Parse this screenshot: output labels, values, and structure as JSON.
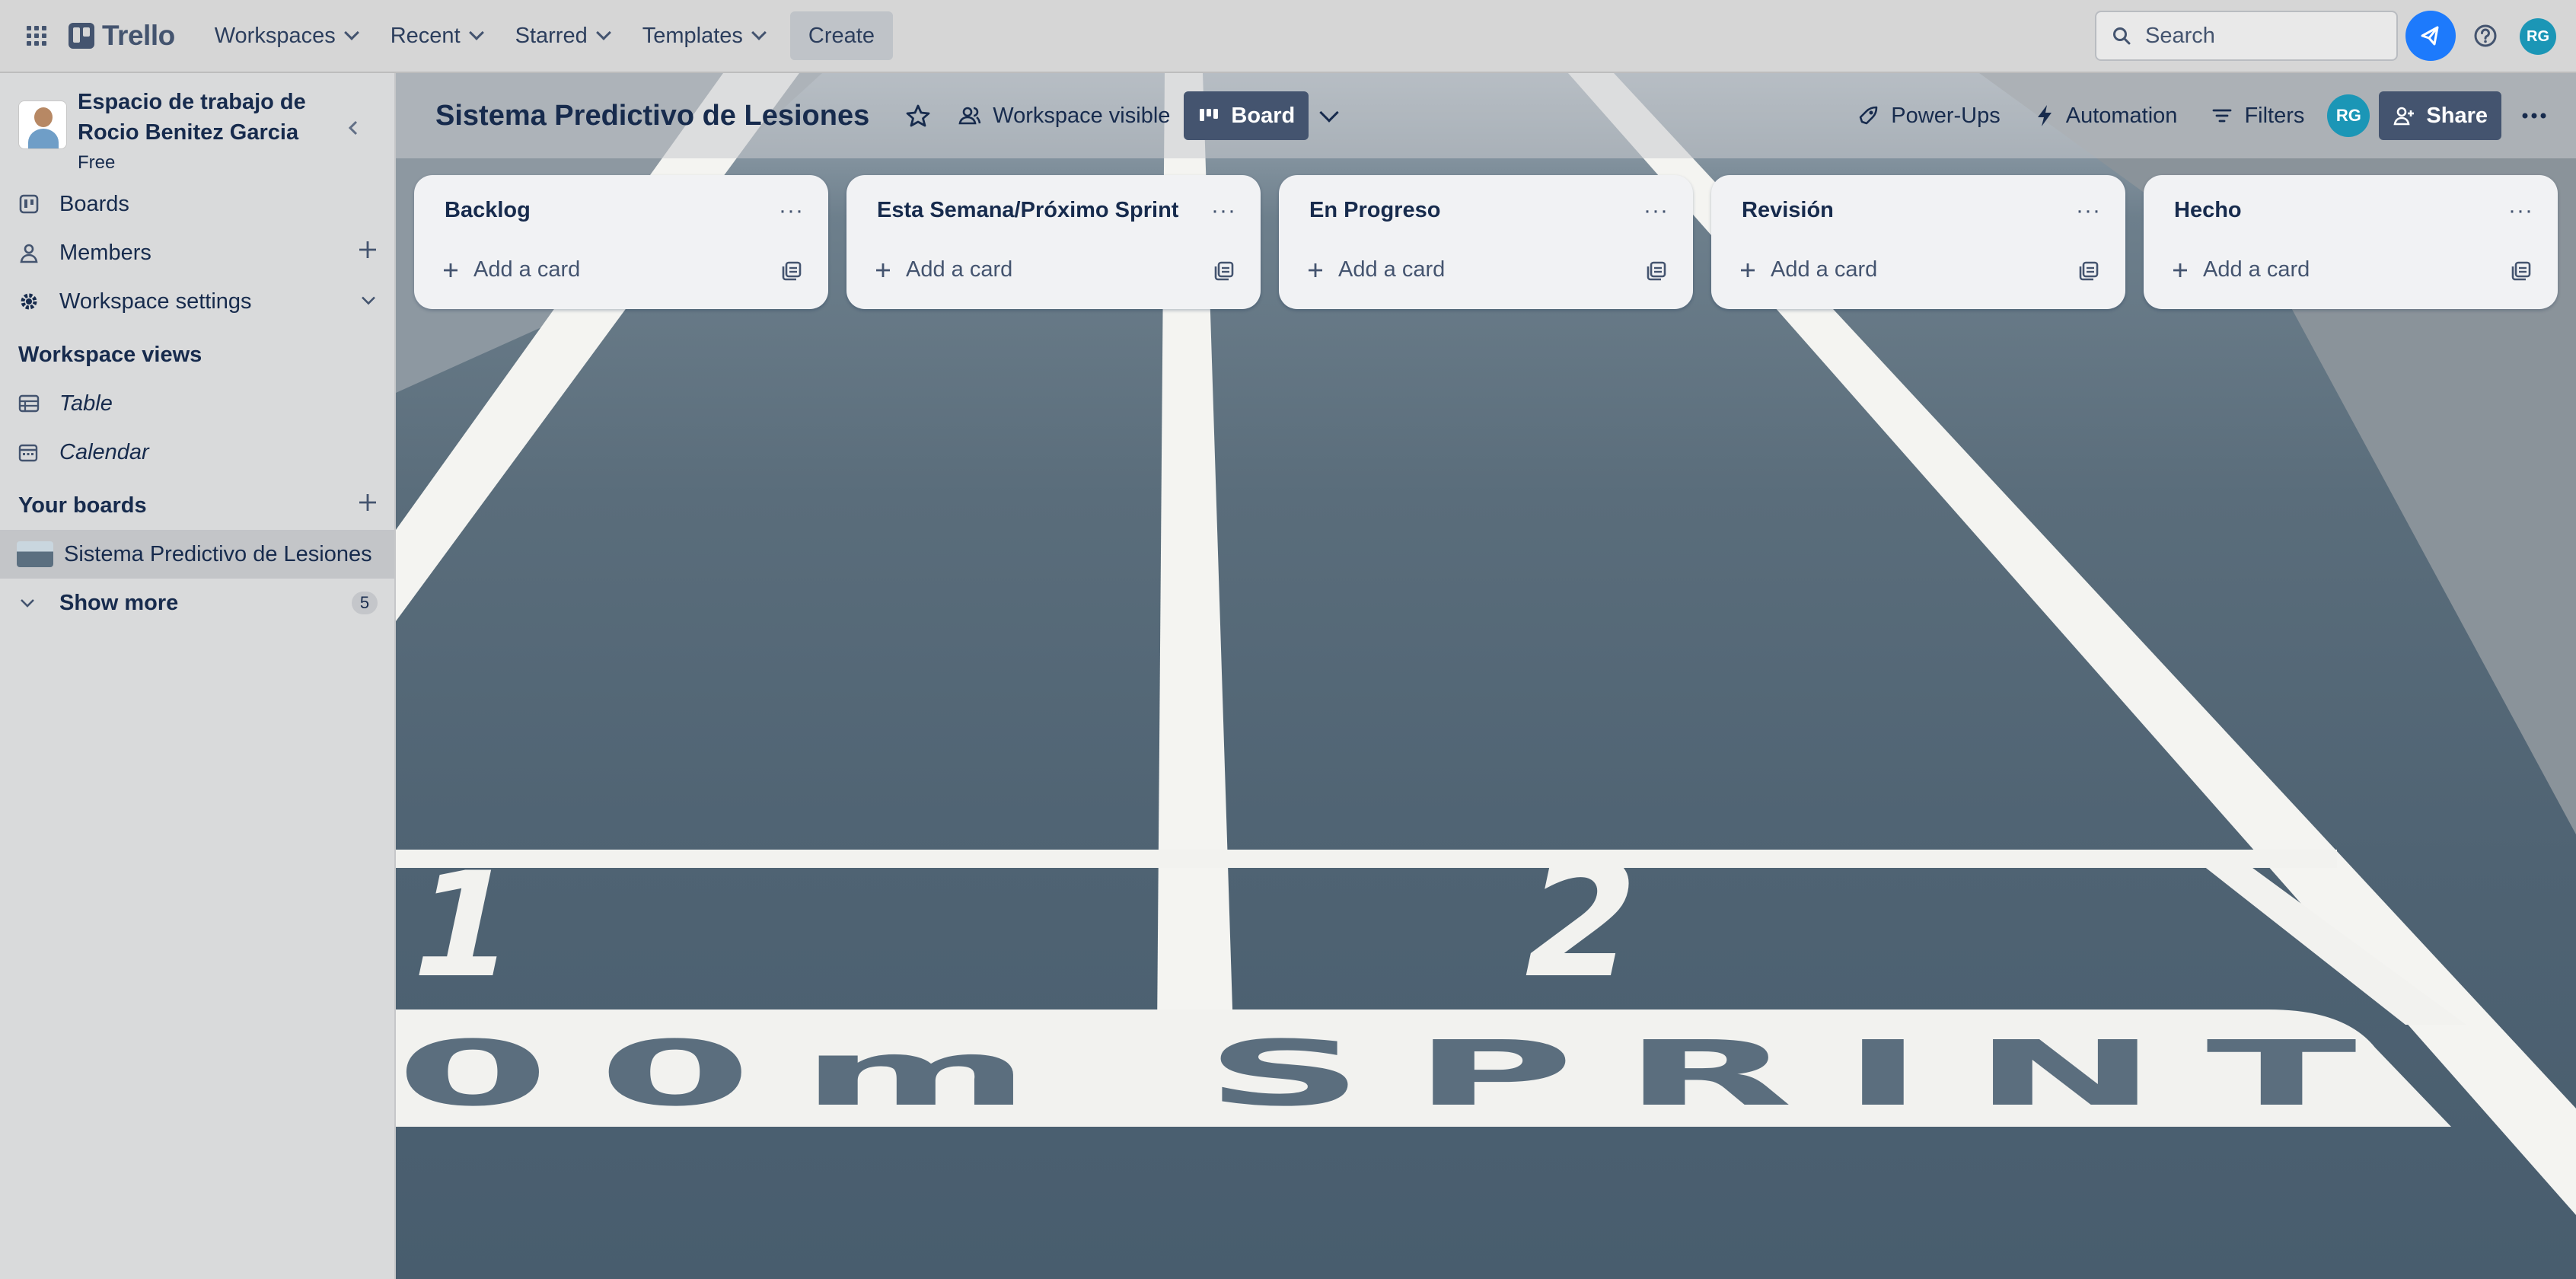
{
  "topnav": {
    "logo": "Trello",
    "menus": [
      "Workspaces",
      "Recent",
      "Starred",
      "Templates"
    ],
    "create_label": "Create",
    "search_placeholder": "Search",
    "avatar_initials": "RG"
  },
  "sidebar": {
    "workspace_name": "Espacio de trabajo de Rocio Benitez Garcia",
    "workspace_plan": "Free",
    "items": [
      {
        "label": "Boards",
        "icon": "trello-board-icon"
      },
      {
        "label": "Members",
        "icon": "person-icon"
      },
      {
        "label": "Workspace settings",
        "icon": "gear-icon"
      }
    ],
    "workspace_views_title": "Workspace views",
    "views": [
      {
        "label": "Table",
        "icon": "table-icon"
      },
      {
        "label": "Calendar",
        "icon": "calendar-icon"
      }
    ],
    "your_boards_title": "Your boards",
    "boards": [
      {
        "label": "Sistema Predictivo de Lesiones"
      }
    ],
    "show_more_label": "Show more",
    "show_more_count": "5"
  },
  "board": {
    "title": "Sistema Predictivo de Lesiones",
    "visibility_label": "Workspace visible",
    "view_label": "Board",
    "powerups_label": "Power-Ups",
    "automation_label": "Automation",
    "filters_label": "Filters",
    "member_initials": "RG",
    "share_label": "Share",
    "track_text_numbers": [
      "1",
      "2"
    ],
    "track_text_word": "00m SPRINT"
  },
  "lists": [
    {
      "title": "Backlog",
      "add_label": "Add a card"
    },
    {
      "title": "Esta Semana/Próximo Sprint",
      "add_label": "Add a card"
    },
    {
      "title": "En Progreso",
      "add_label": "Add a card"
    },
    {
      "title": "Revisión",
      "add_label": "Add a card"
    },
    {
      "title": "Hecho",
      "add_label": "Add a card"
    }
  ],
  "colors": {
    "accent": "#1d7afc",
    "avatar": "#1b96b6",
    "dark_button": "#44546f"
  }
}
